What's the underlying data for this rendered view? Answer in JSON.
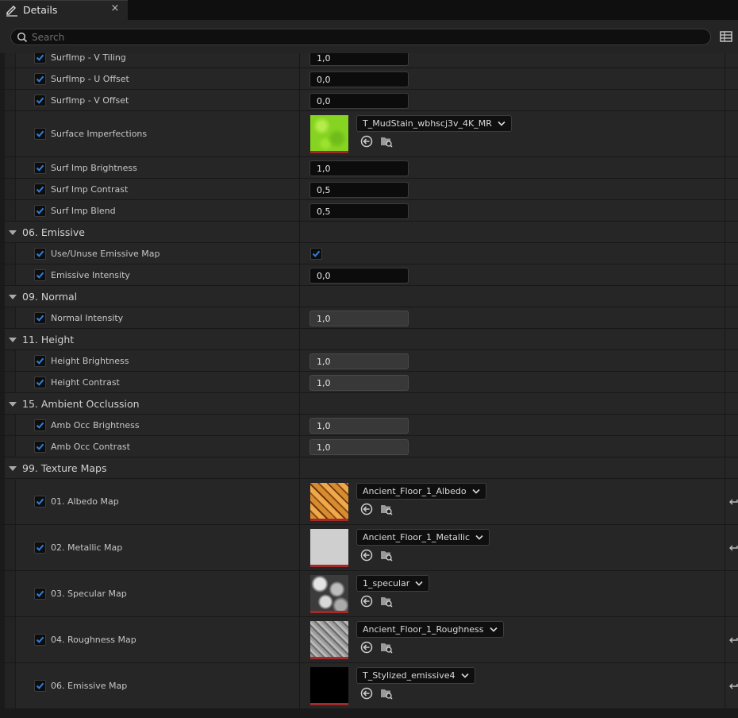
{
  "tab": {
    "title": "Details",
    "close_label": "×"
  },
  "search": {
    "placeholder": "Search",
    "value": ""
  },
  "rows": [
    {
      "kind": "param",
      "label": "SurfImp - V Tiling",
      "value": "1,0",
      "style": "dark"
    },
    {
      "kind": "param",
      "label": "SurfImp - U Offset",
      "value": "0,0",
      "style": "dark"
    },
    {
      "kind": "param",
      "label": "SurfImp - V Offset",
      "value": "0,0",
      "style": "dark"
    },
    {
      "kind": "texture",
      "label": "Surface Imperfections",
      "asset": "T_MudStain_wbhscj3v_4K_MR",
      "thumb": "mud"
    },
    {
      "kind": "param",
      "label": "Surf Imp Brightness",
      "value": "1,0",
      "style": "dark"
    },
    {
      "kind": "param",
      "label": "Surf Imp Contrast",
      "value": "0,5",
      "style": "dark"
    },
    {
      "kind": "param",
      "label": "Surf Imp Blend",
      "value": "0,5",
      "style": "dark"
    },
    {
      "kind": "category",
      "label": "06. Emissive"
    },
    {
      "kind": "bool",
      "label": "Use/Unuse Emissive Map",
      "checked": true
    },
    {
      "kind": "param",
      "label": "Emissive Intensity",
      "value": "0,0",
      "style": "dark"
    },
    {
      "kind": "category",
      "label": "09. Normal"
    },
    {
      "kind": "param",
      "label": "Normal Intensity",
      "value": "1,0",
      "style": "dim"
    },
    {
      "kind": "category",
      "label": "11. Height"
    },
    {
      "kind": "param",
      "label": "Height Brightness",
      "value": "1,0",
      "style": "dim"
    },
    {
      "kind": "param",
      "label": "Height Contrast",
      "value": "1,0",
      "style": "dim"
    },
    {
      "kind": "category",
      "label": "15. Ambient Occlussion"
    },
    {
      "kind": "param",
      "label": "Amb Occ Brightness",
      "value": "1,0",
      "style": "dim"
    },
    {
      "kind": "param",
      "label": "Amb Occ Contrast",
      "value": "1,0",
      "style": "dim"
    },
    {
      "kind": "category",
      "label": "99. Texture Maps"
    },
    {
      "kind": "texture",
      "label": "01. Albedo Map",
      "asset": "Ancient_Floor_1_Albedo",
      "thumb": "albedo",
      "reset": true
    },
    {
      "kind": "texture",
      "label": "02. Metallic Map",
      "asset": "Ancient_Floor_1_Metallic",
      "thumb": "metallic",
      "reset": true
    },
    {
      "kind": "texture",
      "label": "03. Specular Map",
      "asset": "1_specular",
      "thumb": "specular",
      "reset": false
    },
    {
      "kind": "texture",
      "label": "04. Roughness Map",
      "asset": "Ancient_Floor_1_Roughness",
      "thumb": "roughness",
      "reset": true
    },
    {
      "kind": "texture",
      "label": "06. Emissive Map",
      "asset": "T_Stylized_emissive4",
      "thumb": "emissive",
      "reset": true
    }
  ],
  "colors": {
    "accent_check": "#2f7fd9",
    "panel": "#262626",
    "background": "#1a1a1a"
  }
}
